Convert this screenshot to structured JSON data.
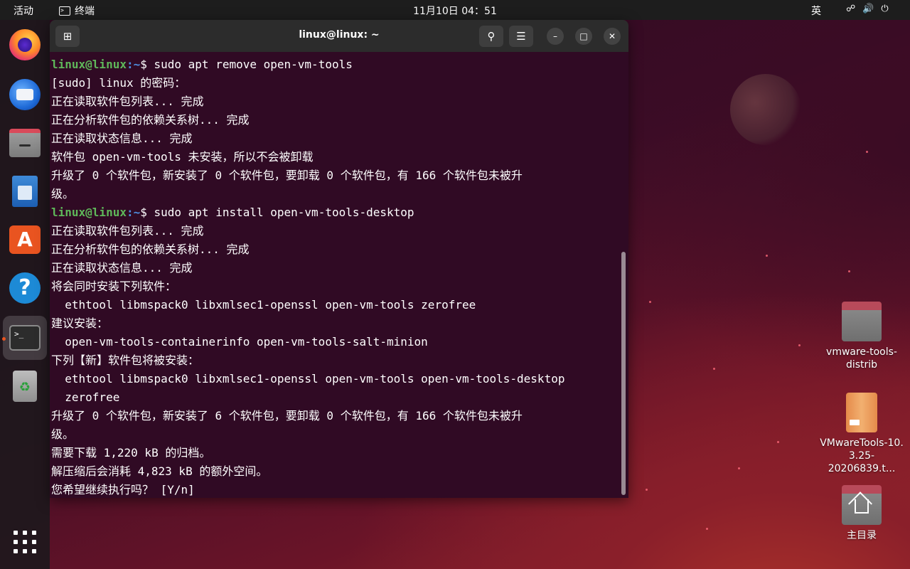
{
  "topbar": {
    "activities": "活动",
    "app_name": "终端",
    "clock": "11月10日  04：51",
    "ime": "英",
    "tray_icons": [
      "network-icon",
      "volume-icon",
      "power-icon"
    ]
  },
  "dock": {
    "items": [
      "firefox",
      "thunderbird",
      "files",
      "libreoffice-writer",
      "app-center",
      "help",
      "terminal",
      "trash"
    ]
  },
  "terminal": {
    "title": "linux@linux: ~",
    "lines": [
      {
        "user": "linux@linux",
        "path": ":~",
        "cmd": "$ sudo apt remove open-vm-tools"
      },
      {
        "text": "[sudo] linux 的密码："
      },
      {
        "text": "正在读取软件包列表... 完成"
      },
      {
        "text": "正在分析软件包的依赖关系树... 完成"
      },
      {
        "text": "正在读取状态信息... 完成"
      },
      {
        "text": "软件包 open-vm-tools 未安装，所以不会被卸载"
      },
      {
        "text": "升级了 0 个软件包，新安装了 0 个软件包，要卸载 0 个软件包，有 166 个软件包未被升"
      },
      {
        "text": "级。"
      },
      {
        "user": "linux@linux",
        "path": ":~",
        "cmd": "$ sudo apt install open-vm-tools-desktop"
      },
      {
        "text": "正在读取软件包列表... 完成"
      },
      {
        "text": "正在分析软件包的依赖关系树... 完成"
      },
      {
        "text": "正在读取状态信息... 完成"
      },
      {
        "text": "将会同时安装下列软件："
      },
      {
        "text": "  ethtool libmspack0 libxmlsec1-openssl open-vm-tools zerofree"
      },
      {
        "text": "建议安装："
      },
      {
        "text": "  open-vm-tools-containerinfo open-vm-tools-salt-minion"
      },
      {
        "text": "下列【新】软件包将被安装："
      },
      {
        "text": "  ethtool libmspack0 libxmlsec1-openssl open-vm-tools open-vm-tools-desktop"
      },
      {
        "text": "  zerofree"
      },
      {
        "text": "升级了 0 个软件包，新安装了 6 个软件包，要卸载 0 个软件包，有 166 个软件包未被升"
      },
      {
        "text": "级。"
      },
      {
        "text": "需要下载 1,220 kB 的归档。"
      },
      {
        "text": "解压缩后会消耗 4,823 kB 的额外空间。"
      },
      {
        "text": "您希望继续执行吗？ [Y/n]"
      }
    ]
  },
  "desktop": {
    "items": [
      {
        "label": "vmware-tools-\ndistrib",
        "type": "folder"
      },
      {
        "label": "VMwareTools-10.\n3.25-20206839.t...",
        "type": "archive"
      },
      {
        "label": "主目录",
        "type": "home"
      }
    ]
  },
  "colors": {
    "terminal_bg": "#300a24",
    "prompt_user": "#5fb85a",
    "prompt_path": "#4e8ee0",
    "accent": "#e95420"
  }
}
